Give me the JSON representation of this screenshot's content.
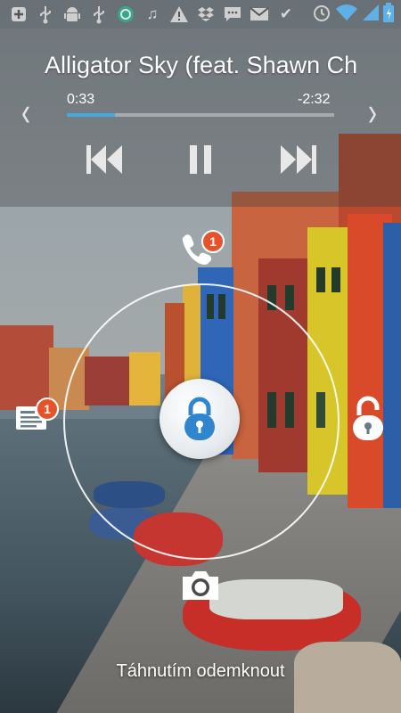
{
  "status_bar": {
    "left_icons": [
      "plus-box-icon",
      "usb-icon",
      "android-icon",
      "usb-icon",
      "circle-app-icon",
      "music-note-icon",
      "warning-icon",
      "dropbox-icon",
      "chat-icon",
      "gmail-icon",
      "check-icon"
    ],
    "right_icons": [
      "alarm-icon",
      "wifi-icon",
      "signal-icon",
      "battery-icon"
    ],
    "accent": "#4aa6e0"
  },
  "music": {
    "title": "Alligator Sky (feat. Shawn Chrystopher)",
    "elapsed": "0:33",
    "remaining": "-2:32",
    "progress_fraction": 0.18
  },
  "lockscreen": {
    "phone_badge": "1",
    "messages_badge": "1",
    "hint": "Táhnutím odemknout"
  }
}
